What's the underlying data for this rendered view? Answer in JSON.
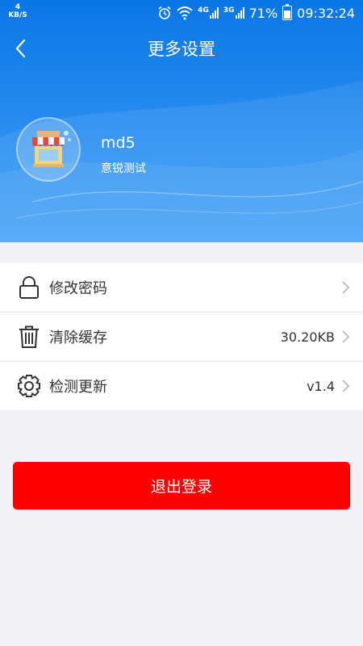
{
  "status_bar": {
    "net_speed_value": "4",
    "net_speed_unit": "KB/S",
    "battery_percent": "71%",
    "time": "09:32:24",
    "network_labels": [
      "4G",
      "3G"
    ]
  },
  "header": {
    "title": "更多设置",
    "back_icon": "chevron-left-icon"
  },
  "profile": {
    "username": "md5",
    "company": "意锐测试",
    "avatar_icon": "storefront-icon"
  },
  "settings": [
    {
      "icon": "lock-icon",
      "label": "修改密码",
      "value": ""
    },
    {
      "icon": "trash-icon",
      "label": "清除缓存",
      "value": "30.20KB"
    },
    {
      "icon": "gear-icon",
      "label": "检测更新",
      "value": "v1.4"
    }
  ],
  "logout": {
    "label": "退出登录"
  },
  "colors": {
    "header_blue": "#0a76e6",
    "logout_red": "#ff0000",
    "page_bg": "#f2f2f6"
  }
}
